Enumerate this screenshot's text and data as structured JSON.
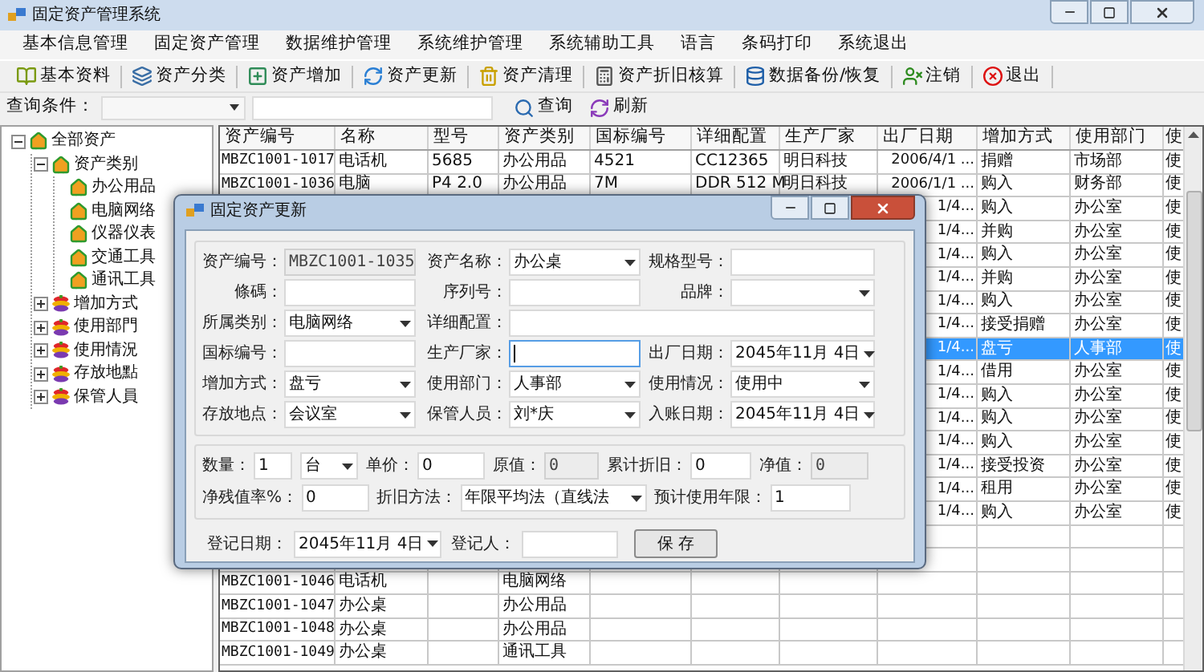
{
  "window": {
    "title": "固定资产管理系统"
  },
  "menu": [
    "基本信息管理",
    "固定资产管理",
    "数据维护管理",
    "系统维护管理",
    "系统辅助工具",
    "语言",
    "条码打印",
    "系统退出"
  ],
  "toolbar": [
    {
      "label": "基本资料",
      "kind": "book"
    },
    {
      "label": "资产分类",
      "kind": "layers"
    },
    {
      "label": "资产增加",
      "kind": "add"
    },
    {
      "label": "资产更新",
      "kind": "update"
    },
    {
      "label": "资产清理",
      "kind": "clear"
    },
    {
      "label": "资产折旧核算",
      "kind": "calc"
    },
    {
      "label": "数据备份/恢复",
      "kind": "backup"
    },
    {
      "label": "注销",
      "kind": "logout"
    },
    {
      "label": "退出",
      "kind": "exit"
    }
  ],
  "query_bar": {
    "label": "查询条件：",
    "buttons": [
      {
        "label": "查询",
        "kind": "search"
      },
      {
        "label": "刷新",
        "kind": "refresh"
      }
    ]
  },
  "tree": [
    {
      "label": "全部资产",
      "kind": "house",
      "expanded": true,
      "children": [
        {
          "label": "资产类别",
          "kind": "house",
          "expanded": true,
          "children": [
            {
              "label": "办公用品",
              "kind": "house"
            },
            {
              "label": "电脑网络",
              "kind": "house"
            },
            {
              "label": "仪器仪表",
              "kind": "house"
            },
            {
              "label": "交通工具",
              "kind": "house"
            },
            {
              "label": "通讯工具",
              "kind": "house"
            }
          ]
        },
        {
          "label": "增加方式",
          "kind": "group",
          "expanded": false
        },
        {
          "label": "使用部門",
          "kind": "group",
          "expanded": false
        },
        {
          "label": "使用情況",
          "kind": "group",
          "expanded": false
        },
        {
          "label": "存放地點",
          "kind": "group",
          "expanded": false
        },
        {
          "label": "保管人員",
          "kind": "group",
          "expanded": false
        }
      ]
    }
  ],
  "table": {
    "columns": [
      "资产编号",
      "名称",
      "型号",
      "资产类别",
      "国标编号",
      "详细配置",
      "生产厂家",
      "出厂日期",
      "增加方式",
      "使用部门",
      "使"
    ],
    "rows": [
      {
        "selected": false,
        "asset_no": "MBZC1001-1017",
        "name": "电话机",
        "model": "5685",
        "category": "办公用品",
        "gb_no": "4521",
        "config": "CC12365",
        "maker": "明日科技",
        "factory_date": "2006/4/1 ...",
        "add_method": "捐赠",
        "department": "市场部",
        "column_11": "使"
      },
      {
        "selected": false,
        "asset_no": "MBZC1001-1036",
        "name": "电脑",
        "model": "P4 2.0",
        "category": "办公用品",
        "gb_no": "7M",
        "config": "DDR 512 M",
        "maker": "明日科技",
        "factory_date": "2006/1/1 ...",
        "add_method": "购入",
        "department": "财务部",
        "column_11": "使"
      },
      {
        "selected": false,
        "factory_date": "1/4...",
        "add_method": "购入",
        "department": "办公室",
        "column_11": "使"
      },
      {
        "selected": false,
        "factory_date": "1/4...",
        "add_method": "并购",
        "department": "办公室",
        "column_11": "使"
      },
      {
        "selected": false,
        "factory_date": "1/4...",
        "add_method": "购入",
        "department": "办公室",
        "column_11": "使"
      },
      {
        "selected": false,
        "factory_date": "1/4...",
        "add_method": "并购",
        "department": "办公室",
        "column_11": "使"
      },
      {
        "selected": false,
        "factory_date": "1/4...",
        "add_method": "购入",
        "department": "办公室",
        "column_11": "使"
      },
      {
        "selected": false,
        "factory_date": "1/4...",
        "add_method": "接受捐赠",
        "department": "办公室",
        "column_11": "使"
      },
      {
        "selected": true,
        "factory_date": "1/4...",
        "add_method": "盘亏",
        "department": "人事部",
        "column_11": "使"
      },
      {
        "selected": false,
        "factory_date": "1/4...",
        "add_method": "借用",
        "department": "办公室",
        "column_11": "使"
      },
      {
        "selected": false,
        "factory_date": "1/4...",
        "add_method": "购入",
        "department": "办公室",
        "column_11": "使"
      },
      {
        "selected": false,
        "factory_date": "1/4...",
        "add_method": "购入",
        "department": "办公室",
        "column_11": "使"
      },
      {
        "selected": false,
        "factory_date": "1/4...",
        "add_method": "购入",
        "department": "办公室",
        "column_11": "使"
      },
      {
        "selected": false,
        "factory_date": "1/4...",
        "add_method": "接受投资",
        "department": "办公室",
        "column_11": "使"
      },
      {
        "selected": false,
        "factory_date": "1/4...",
        "add_method": "租用",
        "department": "办公室",
        "column_11": "使"
      },
      {
        "selected": false,
        "factory_date": "1/4...",
        "add_method": "购入",
        "department": "办公室",
        "column_11": "使"
      },
      {
        "selected": false
      },
      {
        "selected": false
      },
      {
        "selected": false,
        "asset_no": "MBZC1001-1046",
        "name": "电话机",
        "category": "电脑网络"
      },
      {
        "selected": false,
        "asset_no": "MBZC1001-1047",
        "name": "办公桌",
        "category": "办公用品"
      },
      {
        "selected": false,
        "asset_no": "MBZC1001-1048",
        "name": "办公桌",
        "category": "办公用品"
      },
      {
        "selected": false,
        "asset_no": "MBZC1001-1049",
        "name": "办公桌",
        "category": "通讯工具"
      }
    ]
  },
  "dialog": {
    "title": "固定资产更新",
    "form_rows": [
      [
        {
          "label": "资产编号：",
          "kind": "readonly",
          "value": "MBZC1001-1035"
        },
        {
          "label": "资产名称：",
          "kind": "combo",
          "value": "办公桌"
        },
        {
          "label": "规格型号：",
          "kind": "text"
        }
      ],
      [
        {
          "label": "條碼：",
          "kind": "text"
        },
        {
          "label": "序列号：",
          "kind": "text"
        },
        {
          "label": "品牌：",
          "kind": "combo"
        }
      ],
      [
        {
          "label": "所属类别：",
          "kind": "combo",
          "value": "电脑网络"
        },
        {
          "label": "详细配置：",
          "kind": "text"
        }
      ],
      [
        {
          "label": "国标编号：",
          "kind": "text"
        },
        {
          "label": "生产厂家：",
          "kind": "text",
          "focused": true
        },
        {
          "label": "出厂日期：",
          "kind": "date",
          "value": "2045年11月 4日"
        }
      ],
      [
        {
          "label": "增加方式：",
          "kind": "combo",
          "value": "盘亏"
        },
        {
          "label": "使用部门：",
          "kind": "combo",
          "value": "人事部"
        },
        {
          "label": "使用情况：",
          "kind": "combo",
          "value": "使用中"
        }
      ],
      [
        {
          "label": "存放地点：",
          "kind": "combo",
          "value": "会议室"
        },
        {
          "label": "保管人员：",
          "kind": "combo",
          "value": "刘*庆"
        },
        {
          "label": "入账日期：",
          "kind": "date",
          "value": "2045年11月 4日"
        }
      ]
    ],
    "value_rows": [
      [
        {
          "label": "数量：",
          "kind": "text",
          "value": "1"
        },
        {
          "kind": "combo",
          "value": "台"
        },
        {
          "label": "单价：",
          "kind": "text",
          "value": "0"
        },
        {
          "label": "原值：",
          "kind": "readonly",
          "value": "0"
        },
        {
          "label": "累计折旧：",
          "kind": "text",
          "value": "0"
        },
        {
          "label": "净值：",
          "kind": "readonly",
          "value": "0"
        }
      ],
      [
        {
          "label": "净残值率%：",
          "kind": "text",
          "value": "0"
        },
        {
          "label": "折旧方法：",
          "kind": "combo",
          "value": "年限平均法（直线法"
        },
        {
          "label": "预计使用年限：",
          "kind": "text",
          "value": "1"
        }
      ]
    ],
    "footer": [
      {
        "label": "登记日期：",
        "kind": "date",
        "value": "2045年11月 4日"
      },
      {
        "label": "登记人：",
        "kind": "text"
      }
    ],
    "save_button": "保 存"
  }
}
